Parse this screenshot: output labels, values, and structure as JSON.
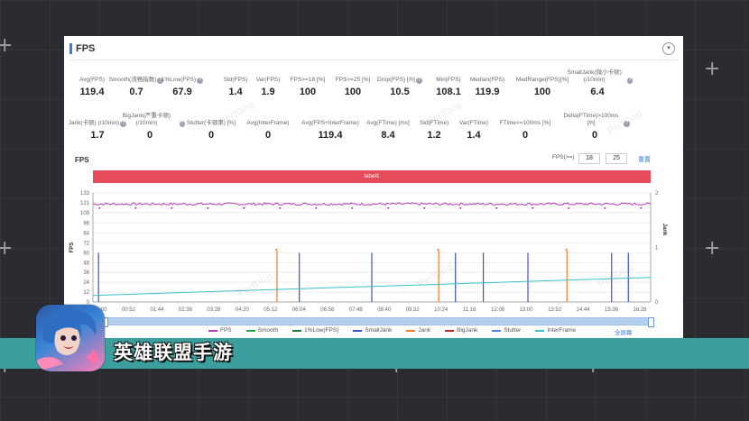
{
  "panel": {
    "title": "FPS",
    "collapse_icon": "▾",
    "metrics_row1": [
      {
        "label": "Avg(FPS)",
        "value": "119.4",
        "help": false
      },
      {
        "label": "Smooth(流畅指数)",
        "value": "0.7",
        "help": true
      },
      {
        "label": "1%Low(FPS)",
        "value": "67.9",
        "help": true
      },
      {
        "label": "Std(FPS)",
        "value": "1.4",
        "help": false
      },
      {
        "label": "Var(FPS)",
        "value": "1.9",
        "help": false
      },
      {
        "label": "FPS>=18 [%]",
        "value": "100",
        "help": false
      },
      {
        "label": "FPS>=25 [%]",
        "value": "100",
        "help": false
      },
      {
        "label": "Drop(FPS) [/h]",
        "value": "10.5",
        "help": true
      },
      {
        "label": "Min(FPS)",
        "value": "108.1",
        "help": false
      },
      {
        "label": "Median(FPS)",
        "value": "119.9",
        "help": false
      },
      {
        "label": "MedRange(FPS)[%]",
        "value": "100",
        "help": false
      },
      {
        "label": "SmallJank(微小卡顿) (/10min)",
        "value": "6.4",
        "help": true
      }
    ],
    "metrics_row2": [
      {
        "label": "Jank(卡顿) (/10min)",
        "value": "1.7",
        "help": true
      },
      {
        "label": "BigJank(严重卡顿) (/10min)",
        "value": "0",
        "help": true
      },
      {
        "label": "Stutter(卡顿率) [%]",
        "value": "0",
        "help": false
      },
      {
        "label": "Avg(InterFrame)",
        "value": "0",
        "help": false
      },
      {
        "label": "Avg(FPS+InterFrame)",
        "value": "119.4",
        "help": false
      },
      {
        "label": "Avg(FTime) [ms]",
        "value": "8.4",
        "help": false
      },
      {
        "label": "Std(FTime)",
        "value": "1.2",
        "help": false
      },
      {
        "label": "Var(FTime)",
        "value": "1.4",
        "help": false
      },
      {
        "label": "FTime>=100ms [%]",
        "value": "0",
        "help": false
      },
      {
        "label": "Delta(FTime)>100ms [/h]",
        "value": "0",
        "help": true
      }
    ],
    "chart_section_label": "FPS",
    "fps_threshold_label": "FPS(>=)",
    "fps_threshold_1": "18",
    "fps_threshold_2": "25",
    "reset_label": "重置",
    "label_bar": "label1",
    "fullscreen_label": "全屏幕",
    "watermark": "PerfDog"
  },
  "chart_data": {
    "type": "line",
    "ylabel": "FPS",
    "y2label": "Jank",
    "yticks": [
      0,
      12,
      24,
      36,
      48,
      60,
      72,
      84,
      96,
      109,
      121,
      133
    ],
    "y2ticks": [
      0,
      1,
      2
    ],
    "ylim": [
      0,
      133
    ],
    "y2lim": [
      0,
      2
    ],
    "xticks": [
      "00:00",
      "00:52",
      "01:44",
      "02:36",
      "03:28",
      "04:20",
      "05:12",
      "06:04",
      "06:56",
      "07:48",
      "08:40",
      "09:32",
      "10:24",
      "11:16",
      "12:08",
      "13:00",
      "13:52",
      "14:44",
      "15:36",
      "16:28"
    ],
    "fps_level": 119.5,
    "interframe_start": 8,
    "interframe_end": 30,
    "smalljank_x": [
      0.01,
      0.37,
      0.5,
      0.65,
      0.7,
      0.78,
      0.93,
      0.96
    ],
    "jank_x": [
      0.33,
      0.62,
      0.85
    ],
    "series": [
      {
        "name": "FPS",
        "color": "#b23ab5"
      },
      {
        "name": "Smooth",
        "color": "#2aa84a"
      },
      {
        "name": "1%Low(FPS)",
        "color": "#1e7a3a"
      },
      {
        "name": "SmallJank",
        "color": "#3c4fd6"
      },
      {
        "name": "Jank",
        "color": "#f07a2a"
      },
      {
        "name": "BigJank",
        "color": "#c0252a"
      },
      {
        "name": "Stutter",
        "color": "#4a84d8"
      },
      {
        "name": "InterFrame",
        "color": "#3cc0c8"
      }
    ]
  },
  "banner": {
    "game_title": "英雄联盟手游"
  }
}
